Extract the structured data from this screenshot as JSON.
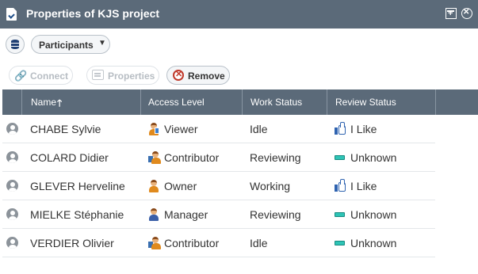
{
  "window": {
    "title": "Properties of KJS project",
    "icons": [
      "document-icon",
      "maximize-icon",
      "close-icon"
    ]
  },
  "toolbar": {
    "dropdown_label": "Participants",
    "connect_label": "Connect",
    "properties_label": "Properties",
    "remove_label": "Remove"
  },
  "grid": {
    "columns": {
      "name": "Name",
      "access": "Access Level",
      "work": "Work Status",
      "review": "Review Status"
    },
    "sort": "ascending",
    "rows": [
      {
        "name": "CHABE Sylvie",
        "access": "Viewer",
        "access_icon": "viewer-icon",
        "work": "Idle",
        "review": "I Like",
        "review_icon": "thumbs-up-icon"
      },
      {
        "name": "COLARD Didier",
        "access": "Contributor",
        "access_icon": "contributor-icon",
        "work": "Reviewing",
        "review": "Unknown",
        "review_icon": "unknown-status-icon"
      },
      {
        "name": "GLEVER Herveline",
        "access": "Owner",
        "access_icon": "owner-icon",
        "work": "Working",
        "review": "I Like",
        "review_icon": "thumbs-up-icon"
      },
      {
        "name": "MIELKE Stéphanie",
        "access": "Manager",
        "access_icon": "manager-icon",
        "work": "Reviewing",
        "review": "Unknown",
        "review_icon": "unknown-status-icon"
      },
      {
        "name": "VERDIER Olivier",
        "access": "Contributor",
        "access_icon": "contributor-icon",
        "work": "Idle",
        "review": "Unknown",
        "review_icon": "unknown-status-icon"
      }
    ]
  },
  "colors": {
    "header_bg": "#5b6a79",
    "remove_red": "#c0392b",
    "like_blue": "#2f63b0",
    "unknown_teal": "#2ec4b6"
  }
}
